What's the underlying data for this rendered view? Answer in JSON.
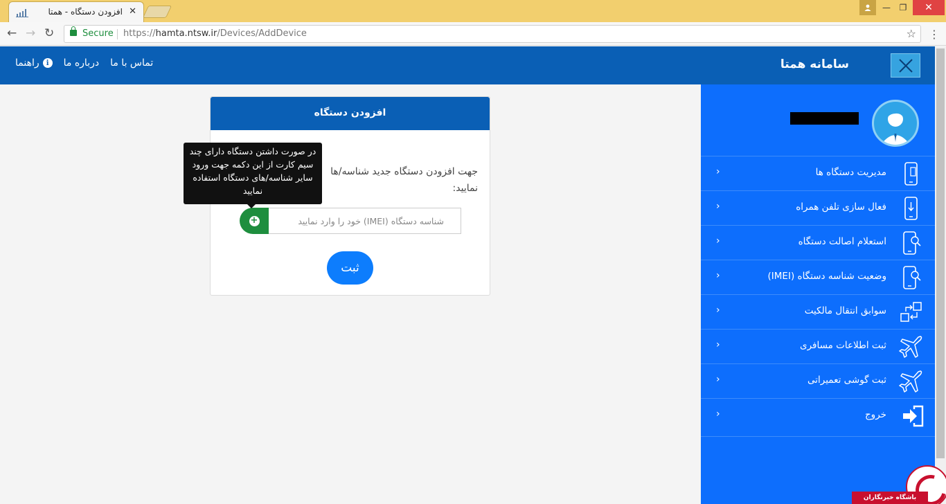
{
  "browser": {
    "tab_title": "افزودن دستگاه - همتا",
    "tab_close": "✕",
    "secure_label": "Secure",
    "url_scheme": "https://",
    "url_host": "hamta.ntsw.ir",
    "url_path": "/Devices/AddDevice",
    "star": "☆",
    "back": "←",
    "forward": "→",
    "reload": "↻",
    "menu": "⋮",
    "win_min": "—",
    "win_max": "❐",
    "win_close": "✕"
  },
  "header": {
    "brand": "سامانه همتا",
    "nav": {
      "contact": "تماس با ما",
      "about": "درباره ما",
      "help": "راهنما"
    }
  },
  "card": {
    "title": "افزودن دستگاه",
    "instruction": "جهت افزودن دستگاه جدید شناسه/ها نمایید:",
    "imei_placeholder": "شناسه دستگاه (IMEI) خود را وارد نمایید",
    "add_symbol": "+",
    "submit_label": "ثبت",
    "tooltip": "در صورت داشتن دستگاه دارای چند سیم کارت از این دکمه جهت ورود سایر شناسه/های دستگاه استفاده نمایید"
  },
  "sidebar": {
    "items": [
      {
        "label": "مدیریت دستگاه ها",
        "icon": "phone-manage-icon"
      },
      {
        "label": "فعال سازی تلفن همراه",
        "icon": "phone-activate-icon"
      },
      {
        "label": "استعلام اصالت دستگاه",
        "icon": "phone-search-icon"
      },
      {
        "label": "وضعیت شناسه دستگاه (IMEI)",
        "icon": "phone-status-icon"
      },
      {
        "label": "سوابق انتقال مالکیت",
        "icon": "transfer-icon"
      },
      {
        "label": "ثبت اطلاعات مسافری",
        "icon": "airplane-icon"
      },
      {
        "label": "ثبت گوشی تعمیراتی",
        "icon": "airplane-icon"
      }
    ],
    "exit_label": "خروج",
    "chevron": "›"
  },
  "watermark": {
    "text": "باشگاه خبرنگاران"
  },
  "colors": {
    "header_blue": "#0a5fb5",
    "sidebar_blue": "#0d6efd",
    "submit_blue": "#0d7dfd",
    "add_green": "#1e8e3e",
    "tabbar_yellow": "#f2cf6e"
  }
}
